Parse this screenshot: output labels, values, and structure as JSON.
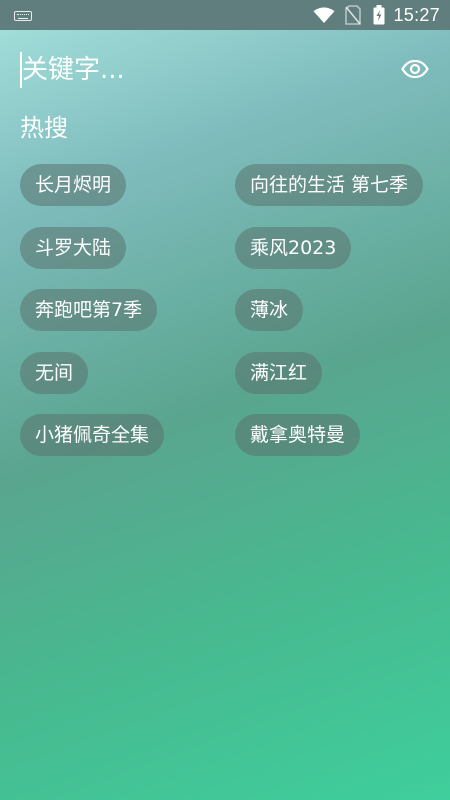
{
  "status_bar": {
    "time": "15:27",
    "icons": [
      "keyboard-icon",
      "wifi-icon",
      "no-sim-icon",
      "battery-charging-icon"
    ]
  },
  "search": {
    "placeholder": "关键字...",
    "visibility_icon": "eye-icon"
  },
  "hot": {
    "title": "热搜",
    "left_column": [
      "长月烬明",
      "斗罗大陆",
      "奔跑吧第7季",
      "无间",
      "小猪佩奇全集"
    ],
    "right_column": [
      "向往的生活 第七季",
      "乘风2023",
      "薄冰",
      "满江红",
      "戴拿奥特曼"
    ]
  }
}
